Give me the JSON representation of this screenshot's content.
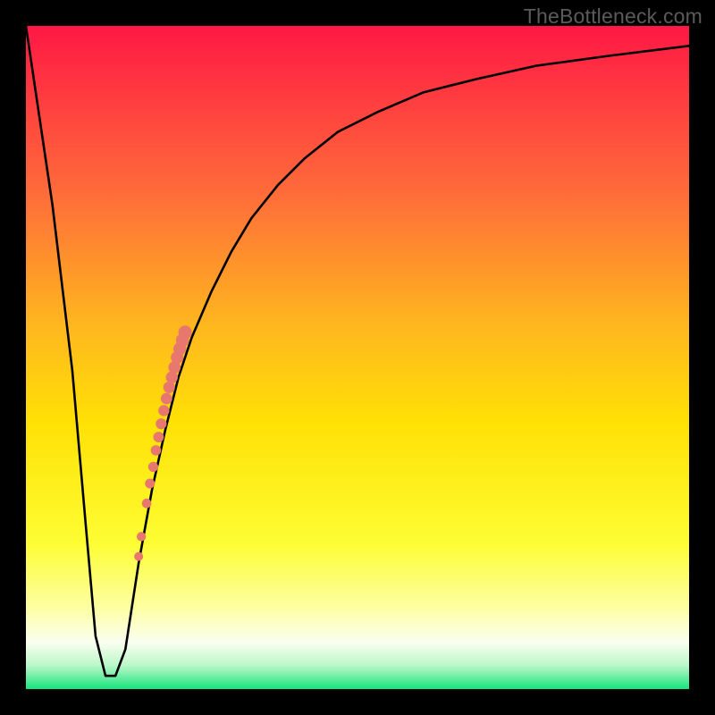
{
  "watermark": "TheBottleneck.com",
  "colors": {
    "background": "#000000",
    "curve": "#000000",
    "markers": "#e8776e",
    "watermark": "#5b5b5b"
  },
  "chart_data": {
    "type": "line",
    "title": "",
    "xlabel": "",
    "ylabel": "",
    "xlim": [
      0,
      100
    ],
    "ylim": [
      0,
      100
    ],
    "grid": false,
    "legend": false,
    "gradient_stops": [
      {
        "offset": 0.0,
        "color": "#ff1844"
      },
      {
        "offset": 0.25,
        "color": "#ff6b3a"
      },
      {
        "offset": 0.45,
        "color": "#ffb61f"
      },
      {
        "offset": 0.6,
        "color": "#ffe105"
      },
      {
        "offset": 0.78,
        "color": "#fdfd33"
      },
      {
        "offset": 0.88,
        "color": "#fdffa6"
      },
      {
        "offset": 0.93,
        "color": "#fafff0"
      },
      {
        "offset": 0.965,
        "color": "#b9f7c8"
      },
      {
        "offset": 1.0,
        "color": "#17e47b"
      }
    ],
    "series": [
      {
        "name": "bottleneck-curve",
        "x": [
          0,
          4,
          7,
          9,
          10.5,
          12,
          13.5,
          15,
          17,
          19,
          21,
          23,
          25,
          28,
          31,
          34,
          38,
          42,
          47,
          53,
          60,
          68,
          77,
          88,
          100
        ],
        "y": [
          100,
          73,
          48,
          25,
          8,
          2,
          2,
          6,
          19,
          30,
          39,
          47,
          53,
          60,
          66,
          71,
          76,
          80,
          84,
          87,
          90,
          92,
          94,
          95.5,
          97
        ]
      }
    ],
    "markers": {
      "name": "highlight-points",
      "x": [
        17.0,
        17.4,
        18.2,
        18.7,
        19.2,
        19.6,
        20.0,
        20.4,
        20.8,
        21.2,
        21.6,
        22.0,
        22.4,
        22.8,
        23.2,
        23.6,
        24.0
      ],
      "y": [
        20.0,
        23.0,
        28.0,
        31.0,
        33.5,
        36.0,
        38.0,
        40.0,
        42.0,
        43.8,
        45.5,
        47.0,
        48.5,
        50.0,
        51.3,
        52.6,
        53.8
      ],
      "radius_top": 7.5,
      "radius_bottom": 5.0
    }
  }
}
